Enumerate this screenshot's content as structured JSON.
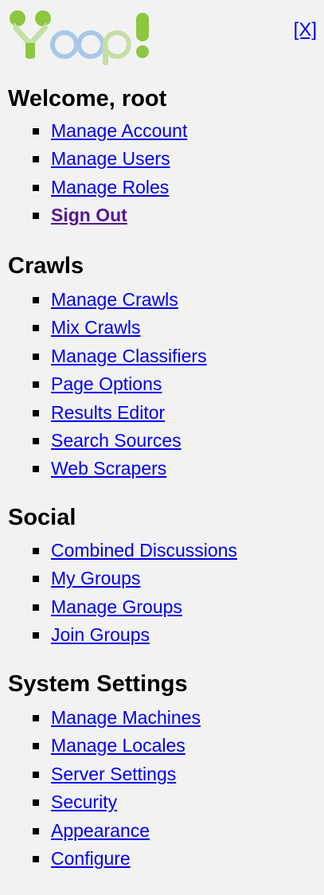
{
  "brand": {
    "logo_text": "Yioop!",
    "colors": {
      "logo_green": "#8dc63f",
      "logo_light_green": "#c5e0a5",
      "logo_blue": "#6f9ecf",
      "logo_light_blue": "#a9c8e8",
      "link": "#0000ee",
      "visited_link": "#551a8b",
      "panel_background": "#f2f2f2"
    }
  },
  "close": {
    "label": "[X]"
  },
  "sections": [
    {
      "heading": "Welcome, root",
      "items": [
        {
          "label": "Manage Account"
        },
        {
          "label": "Manage Users"
        },
        {
          "label": "Manage Roles"
        },
        {
          "label": "Sign Out",
          "state": "visited-bold"
        }
      ]
    },
    {
      "heading": "Crawls",
      "items": [
        {
          "label": "Manage Crawls"
        },
        {
          "label": "Mix Crawls"
        },
        {
          "label": "Manage Classifiers"
        },
        {
          "label": "Page Options"
        },
        {
          "label": "Results Editor"
        },
        {
          "label": "Search Sources"
        },
        {
          "label": "Web Scrapers"
        }
      ]
    },
    {
      "heading": "Social",
      "items": [
        {
          "label": "Combined Discussions"
        },
        {
          "label": "My Groups"
        },
        {
          "label": "Manage Groups"
        },
        {
          "label": "Join Groups"
        }
      ]
    },
    {
      "heading": "System Settings",
      "items": [
        {
          "label": "Manage Machines"
        },
        {
          "label": "Manage Locales"
        },
        {
          "label": "Server Settings"
        },
        {
          "label": "Security"
        },
        {
          "label": "Appearance"
        },
        {
          "label": "Configure"
        }
      ]
    }
  ]
}
